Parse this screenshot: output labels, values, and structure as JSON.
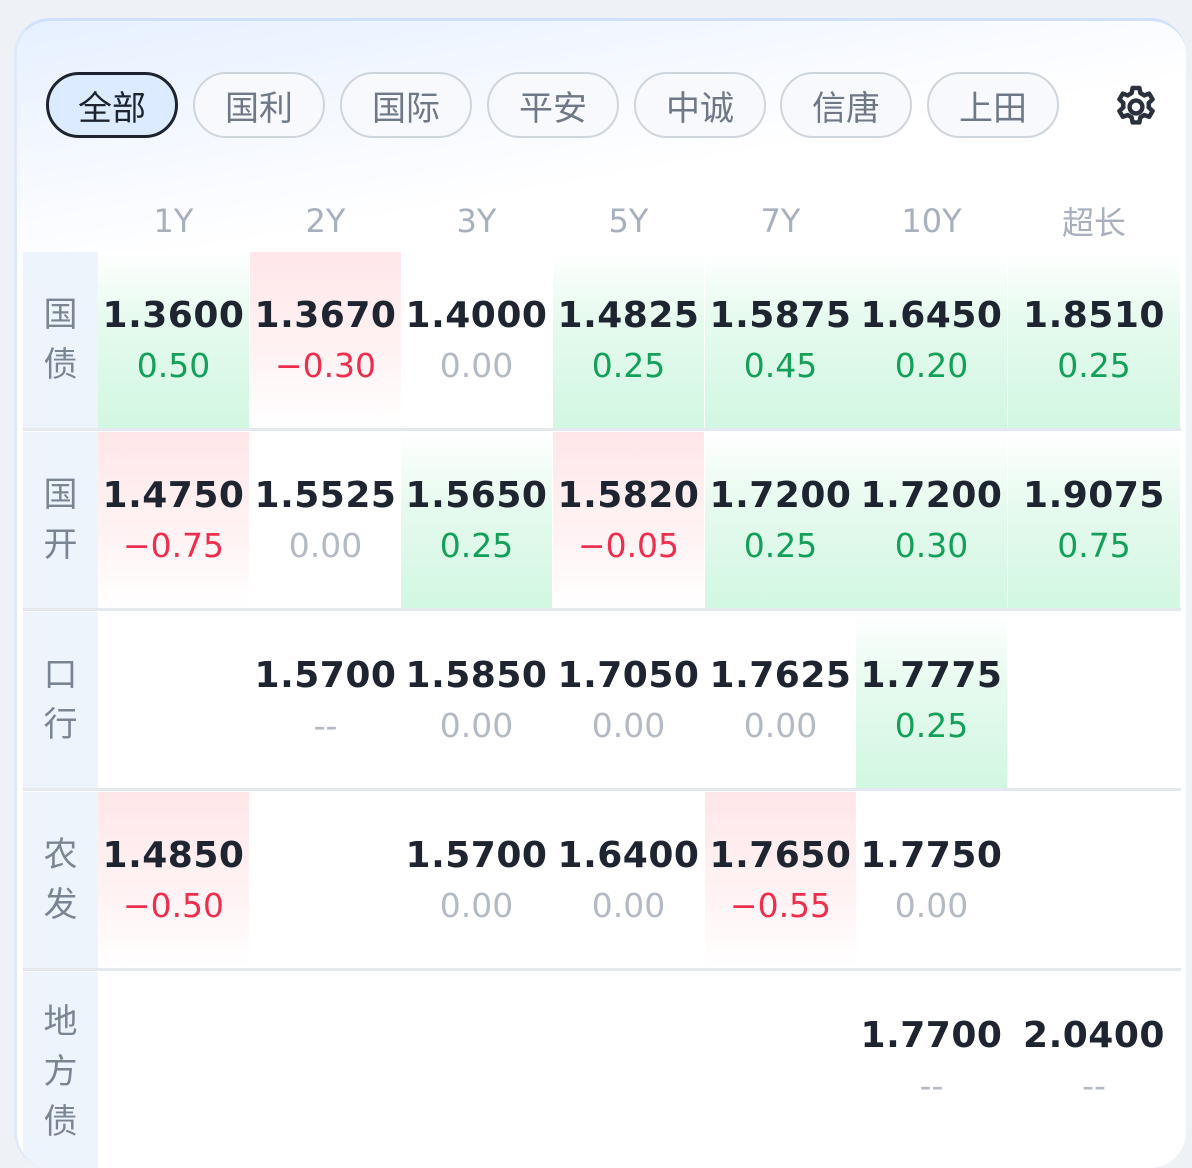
{
  "tabs": [
    {
      "label": "全部",
      "active": true
    },
    {
      "label": "国利",
      "active": false
    },
    {
      "label": "国际",
      "active": false
    },
    {
      "label": "平安",
      "active": false
    },
    {
      "label": "中诚",
      "active": false
    },
    {
      "label": "信唐",
      "active": false
    },
    {
      "label": "上田",
      "active": false
    }
  ],
  "settings_icon": "gear-icon",
  "columns": [
    "1Y",
    "2Y",
    "3Y",
    "5Y",
    "7Y",
    "10Y",
    "超长"
  ],
  "rows": [
    {
      "label": [
        "国",
        "债"
      ],
      "cells": [
        {
          "rate": "1.3600",
          "change": "0.50",
          "trend": "up"
        },
        {
          "rate": "1.3670",
          "change": "−0.30",
          "trend": "down"
        },
        {
          "rate": "1.4000",
          "change": "0.00",
          "trend": "flat"
        },
        {
          "rate": "1.4825",
          "change": "0.25",
          "trend": "up"
        },
        {
          "rate": "1.5875",
          "change": "0.45",
          "trend": "up"
        },
        {
          "rate": "1.6450",
          "change": "0.20",
          "trend": "up"
        },
        {
          "rate": "1.8510",
          "change": "0.25",
          "trend": "up"
        }
      ]
    },
    {
      "label": [
        "国",
        "开"
      ],
      "cells": [
        {
          "rate": "1.4750",
          "change": "−0.75",
          "trend": "down"
        },
        {
          "rate": "1.5525",
          "change": "0.00",
          "trend": "flat"
        },
        {
          "rate": "1.5650",
          "change": "0.25",
          "trend": "up"
        },
        {
          "rate": "1.5820",
          "change": "−0.05",
          "trend": "down"
        },
        {
          "rate": "1.7200",
          "change": "0.25",
          "trend": "up"
        },
        {
          "rate": "1.7200",
          "change": "0.30",
          "trend": "up"
        },
        {
          "rate": "1.9075",
          "change": "0.75",
          "trend": "up"
        }
      ]
    },
    {
      "label": [
        "口",
        "行"
      ],
      "cells": [
        null,
        {
          "rate": "1.5700",
          "change": "--",
          "trend": "flat"
        },
        {
          "rate": "1.5850",
          "change": "0.00",
          "trend": "flat"
        },
        {
          "rate": "1.7050",
          "change": "0.00",
          "trend": "flat"
        },
        {
          "rate": "1.7625",
          "change": "0.00",
          "trend": "flat"
        },
        {
          "rate": "1.7775",
          "change": "0.25",
          "trend": "up"
        },
        null
      ]
    },
    {
      "label": [
        "农",
        "发"
      ],
      "cells": [
        {
          "rate": "1.4850",
          "change": "−0.50",
          "trend": "down"
        },
        null,
        {
          "rate": "1.5700",
          "change": "0.00",
          "trend": "flat"
        },
        {
          "rate": "1.6400",
          "change": "0.00",
          "trend": "flat"
        },
        {
          "rate": "1.7650",
          "change": "−0.55",
          "trend": "down"
        },
        {
          "rate": "1.7750",
          "change": "0.00",
          "trend": "flat"
        },
        null
      ]
    },
    {
      "label": [
        "地",
        "方",
        "债"
      ],
      "cells": [
        null,
        null,
        null,
        null,
        null,
        {
          "rate": "1.7700",
          "change": "--",
          "trend": "flat"
        },
        {
          "rate": "2.0400",
          "change": "--",
          "trend": "flat"
        }
      ]
    }
  ]
}
